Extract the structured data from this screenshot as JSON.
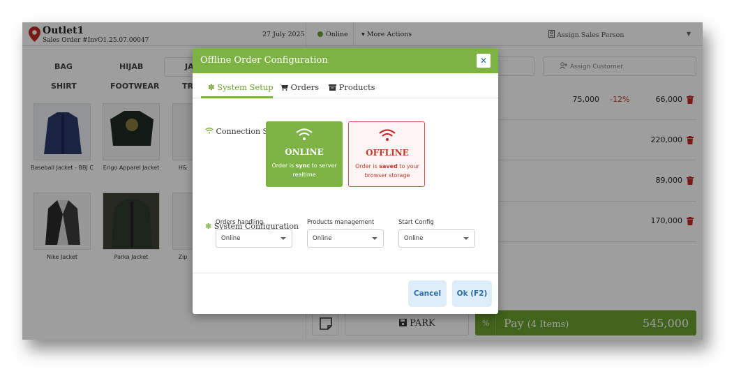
{
  "header": {
    "outlet_name": "Outlet1",
    "order_label": "Sales Order #InvO1.25.07.00047",
    "date": "27 July 2025",
    "status": "Online",
    "more_actions": "More Actions",
    "assign_sales_person": "Assign Sales Person"
  },
  "categories": [
    "BAG",
    "HIJAB",
    "JA",
    "SHIRT",
    "FOOTWEAR",
    "TR"
  ],
  "products": [
    {
      "name": "Baseball Jacket - BBJ C"
    },
    {
      "name": "Erigo Apparel Jacket"
    },
    {
      "name": "H&"
    },
    {
      "name": "Nike Jacket"
    },
    {
      "name": "Parka Jacket"
    },
    {
      "name": "Zip"
    }
  ],
  "customer": {
    "placeholder": "Assign Customer"
  },
  "cart": {
    "rows": [
      {
        "price": "75,000",
        "discount": "-12%",
        "total": "66,000"
      },
      {
        "price": "",
        "discount": "",
        "total": "220,000"
      },
      {
        "price": "",
        "discount": "",
        "total": "89,000"
      },
      {
        "price": "",
        "discount": "",
        "total": "170,000"
      }
    ],
    "park_label": "PARK",
    "pay_label": "Pay",
    "pay_items": "(4 Items)",
    "pay_total": "545,000",
    "percent_symbol": "%"
  },
  "modal": {
    "title": "Offline Order Configuration",
    "close_symbol": "✕",
    "tabs": [
      {
        "label": "System Setup",
        "active": true
      },
      {
        "label": "Orders",
        "active": false
      },
      {
        "label": "Products",
        "active": false
      }
    ],
    "connection_status_title": "Connection Status",
    "online_card": {
      "title": "ONLINE",
      "desc_pre": "Order is ",
      "desc_strong": "sync",
      "desc_post": " to server realtime"
    },
    "offline_card": {
      "title": "OFFLINE",
      "desc_pre": "Order is ",
      "desc_strong": "saved",
      "desc_post": " to your browser storage"
    },
    "system_config_title": "System Configuration",
    "fields": [
      {
        "label": "Orders handling",
        "value": "Online"
      },
      {
        "label": "Products management",
        "value": "Online"
      },
      {
        "label": "Start Config",
        "value": "Online"
      }
    ],
    "cancel_label": "Cancel",
    "ok_label": "Ok (F2)"
  },
  "colors": {
    "accent": "#7cb342",
    "danger": "#c0392b",
    "link": "#2e6da4"
  }
}
